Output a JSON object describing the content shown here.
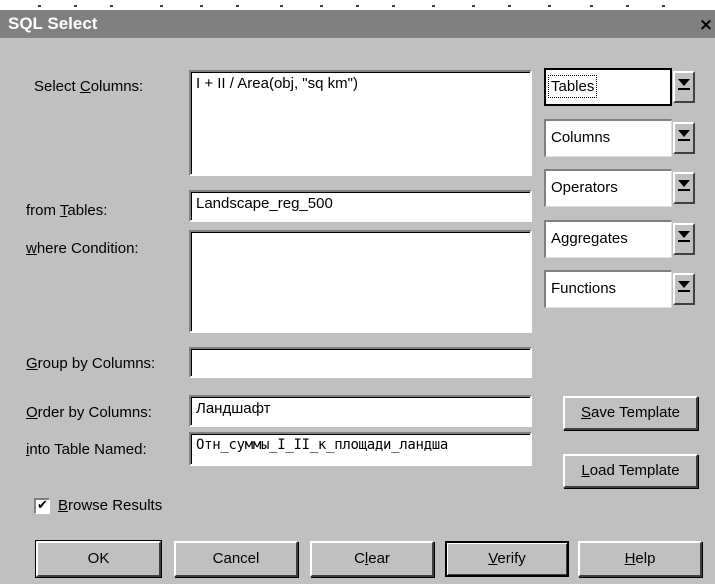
{
  "window": {
    "title": "SQL Select",
    "close_glyph": "×"
  },
  "labels": {
    "select_columns": {
      "pre": "Select ",
      "key": "C",
      "post": "olumns:"
    },
    "from_tables": {
      "pre": "from ",
      "key": "T",
      "post": "ables:"
    },
    "where_condition": {
      "pre": "",
      "key": "w",
      "post": "here Condition:"
    },
    "group_by": {
      "pre": "",
      "key": "G",
      "post": "roup by Columns:"
    },
    "order_by": {
      "pre": "",
      "key": "O",
      "post": "rder by Columns:"
    },
    "into_table": {
      "pre": "",
      "key": "i",
      "post": "nto Table Named:"
    }
  },
  "fields": {
    "select_columns": "I + II / Area(obj, \"sq km\")",
    "from_tables": "Landscape_reg_500",
    "where_condition": "",
    "group_by": "",
    "order_by": "Ландшафт",
    "into_table": "Отн_суммы_I_II_к_площади_ландша"
  },
  "dropdowns": [
    {
      "label": "Tables"
    },
    {
      "label": "Columns"
    },
    {
      "label": "Operators"
    },
    {
      "label": "Aggregates"
    },
    {
      "label": "Functions"
    }
  ],
  "browse_results": {
    "checked": true,
    "check_glyph": "✔",
    "pre": "",
    "key": "B",
    "post": "rowse Results"
  },
  "template_buttons": {
    "save": {
      "pre": "",
      "key": "S",
      "post": "ave Template"
    },
    "load": {
      "pre": "",
      "key": "L",
      "post": "oad Template"
    }
  },
  "buttons": {
    "ok": {
      "pre": "OK",
      "key": "",
      "post": ""
    },
    "cancel": {
      "pre": "Cancel",
      "key": "",
      "post": ""
    },
    "clear": {
      "pre": "C",
      "key": "l",
      "post": "ear"
    },
    "verify": {
      "pre": "",
      "key": "V",
      "post": "erify"
    },
    "help": {
      "pre": "",
      "key": "H",
      "post": "elp"
    }
  },
  "icons": {
    "dropdown": "chevron-down-bar-icon",
    "close": "close-icon",
    "checkbox": "checkmark-icon"
  }
}
